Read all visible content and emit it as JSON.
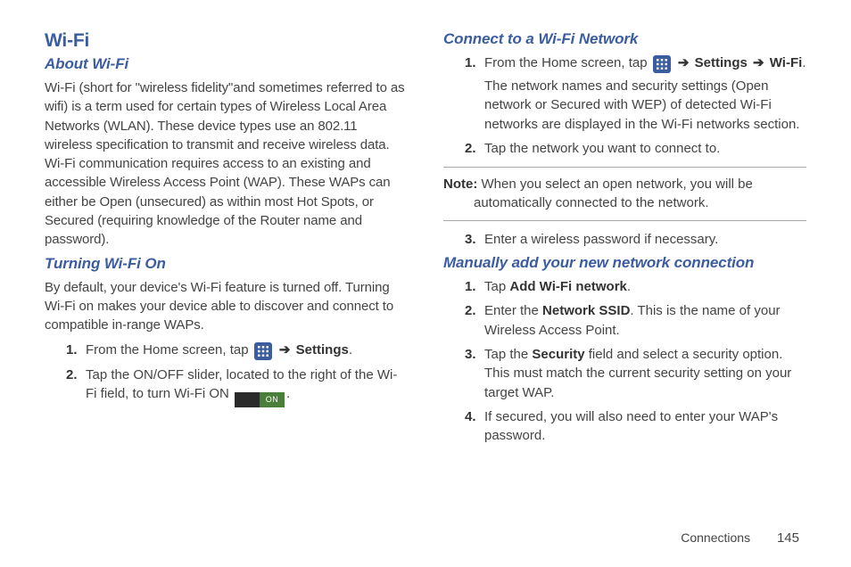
{
  "left": {
    "mainHeading": "Wi-Fi",
    "sub1": "About Wi-Fi",
    "para1": "Wi-Fi (short for \"wireless fidelity\"and sometimes referred to as wifi) is a term used for certain types of Wireless Local Area Networks (WLAN). These device types use an 802.11 wireless specification to transmit and receive wireless data. Wi-Fi communication requires access to an existing and accessible Wireless Access Point (WAP). These WAPs can either be Open (unsecured) as within most Hot Spots, or Secured (requiring knowledge of the Router name and password).",
    "sub2": "Turning Wi-Fi On",
    "para2": "By default, your device's Wi-Fi feature is turned off. Turning Wi-Fi on makes your device able to discover and connect to compatible in-range WAPs.",
    "steps": {
      "s1_a": "From the Home screen, tap ",
      "s1_arrow": "➔",
      "s1_settings": "Settings",
      "s1_end": ".",
      "s2_a": "Tap the ON/OFF slider, located to the right of the Wi-Fi field, to turn Wi-Fi ON ",
      "s2_on": "ON",
      "s2_end": "."
    }
  },
  "right": {
    "sub1": "Connect to a Wi-Fi Network",
    "steps1": {
      "s1_a": "From the Home screen, tap ",
      "s1_arrow": "➔",
      "s1_settings": "Settings",
      "s1_wifi": "Wi-Fi",
      "s1_end": ".",
      "s1_body": "The network names and security settings (Open network or Secured with WEP) of detected Wi-Fi networks are displayed in the Wi-Fi networks section.",
      "s2": "Tap the network you want to connect to."
    },
    "noteLabel": "Note:",
    "noteFirst": " When you select an open network, you will be",
    "noteRest": "automatically connected to the network.",
    "s3": "Enter a wireless password if necessary.",
    "sub2": "Manually add your new network connection",
    "steps2": {
      "s1_a": " Tap ",
      "s1_b": "Add Wi-Fi network",
      "s1_c": ".",
      "s2_a": " Enter the ",
      "s2_b": "Network SSID",
      "s2_c": ". This is the name of your Wireless Access Point.",
      "s3_a": "Tap the ",
      "s3_b": "Security",
      "s3_c": " field and select a security option. This must match the current security setting on your target WAP.",
      "s4": " If secured, you will also need to enter your WAP's password."
    }
  },
  "footer": {
    "section": "Connections",
    "page": "145"
  },
  "nums": {
    "n1": "1.",
    "n2": "2.",
    "n3": "3.",
    "n4": "4."
  }
}
